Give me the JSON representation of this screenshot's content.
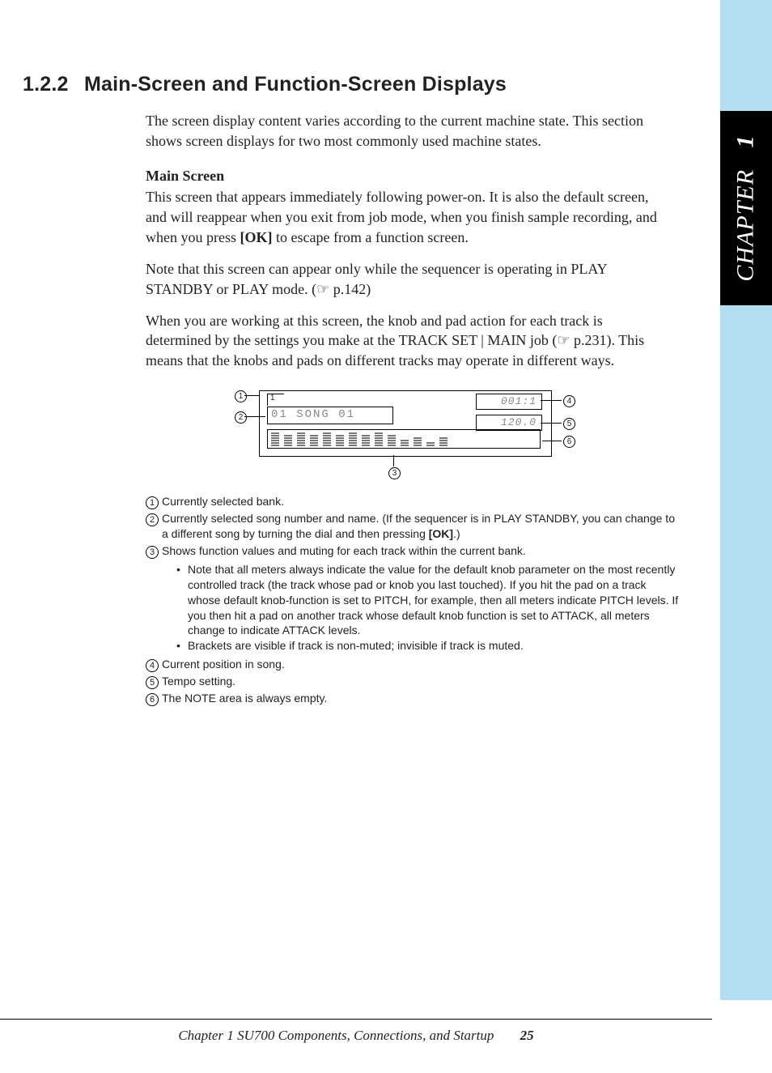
{
  "chapter_tab": {
    "label": "CHAPTER",
    "number": "1"
  },
  "heading": {
    "number": "1.2.2",
    "title": "Main-Screen and Function-Screen Displays"
  },
  "intro": "The screen display content varies according to the current machine state. This section shows screen displays for two most commonly used machine states.",
  "subhead": "Main Screen",
  "para1_a": "This screen that appears immediately following power-on. It is also the default screen, and will reappear when you exit from job mode, when you finish sample recording, and when you press ",
  "para1_ok": "[OK]",
  "para1_b": " to escape from a function screen.",
  "para2_a": "Note that this screen can appear only while the sequencer is operating in PLAY STANDBY or PLAY mode. (",
  "para2_ref": "☞ p.142",
  "para2_b": ")",
  "para3_a": "When you are working at this screen, the knob and pad action for each track is determined by the settings you make at the TRACK SET | MAIN job (",
  "para3_ref": "☞ p.231",
  "para3_b": "). This means that the knobs and pads on different tracks may operate in different ways.",
  "diagram": {
    "bank": "1",
    "song": "01 SONG 01",
    "position": "001:1",
    "tempo": "120.0",
    "meter_heights": [
      6,
      5,
      6,
      5,
      6,
      5,
      6,
      5,
      6,
      5,
      3,
      4,
      2,
      4
    ],
    "callouts": {
      "c1": "1",
      "c2": "2",
      "c3": "3",
      "c4": "4",
      "c5": "5",
      "c6": "6"
    }
  },
  "notes": [
    {
      "n": "1",
      "text": "Currently selected bank."
    },
    {
      "n": "2",
      "text_a": "Currently selected song number and name. (If the sequencer is in PLAY STANDBY, you can change to a different song by turning the dial and then pressing ",
      "bold": "[OK]",
      "text_b": ".)"
    },
    {
      "n": "3",
      "text": "Shows function values and muting for each track within the current bank.",
      "bullets": [
        "Note that all meters always indicate the value for the default knob parameter on the most recently controlled track (the track whose pad or knob you last touched). If you hit the pad on a track whose default knob-function is set to PITCH, for example, then all meters indicate PITCH levels. If you then hit a pad on another track whose default knob function is set to ATTACK, all meters change to indicate ATTACK levels.",
        "Brackets are visible if track is non-muted; invisible if track is muted."
      ]
    },
    {
      "n": "4",
      "text": "Current position in song."
    },
    {
      "n": "5",
      "text": "Tempo setting."
    },
    {
      "n": "6",
      "text": "The NOTE area is always empty."
    }
  ],
  "footer": {
    "text": "Chapter 1   SU700 Components, Connections, and Startup",
    "page": "25"
  }
}
